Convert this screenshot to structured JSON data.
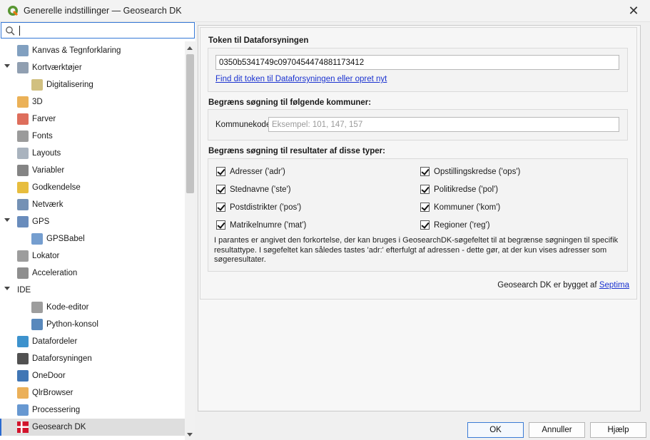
{
  "window": {
    "title": "Generelle indstillinger — Geosearch DK",
    "close_glyph": "✕"
  },
  "search": {
    "value": "",
    "placeholder": ""
  },
  "sidebar": {
    "items": [
      {
        "label": "Kanvas & Tegnforklaring",
        "icon": "canvas-icon",
        "indent": 0
      },
      {
        "label": "Kortværktøjer",
        "icon": "map-tools-icon",
        "indent": 0,
        "expanded": true
      },
      {
        "label": "Digitalisering",
        "icon": "digitizing-icon",
        "indent": 1
      },
      {
        "label": "3D",
        "icon": "3d-icon",
        "indent": 0
      },
      {
        "label": "Farver",
        "icon": "colors-icon",
        "indent": 0
      },
      {
        "label": "Fonts",
        "icon": "fonts-icon",
        "indent": 0
      },
      {
        "label": "Layouts",
        "icon": "layouts-icon",
        "indent": 0
      },
      {
        "label": "Variabler",
        "icon": "variables-icon",
        "indent": 0
      },
      {
        "label": "Godkendelse",
        "icon": "lock-icon",
        "indent": 0
      },
      {
        "label": "Netværk",
        "icon": "network-icon",
        "indent": 0
      },
      {
        "label": "GPS",
        "icon": "gps-icon",
        "indent": 0,
        "expanded": true
      },
      {
        "label": "GPSBabel",
        "icon": "gpsbabel-icon",
        "indent": 1
      },
      {
        "label": "Lokator",
        "icon": "locator-icon",
        "indent": 0
      },
      {
        "label": "Acceleration",
        "icon": "acceleration-icon",
        "indent": 0
      },
      {
        "label": "IDE",
        "icon": "",
        "indent": 0,
        "expanded": true
      },
      {
        "label": "Kode-editor",
        "icon": "code-editor-icon",
        "indent": 1
      },
      {
        "label": "Python-konsol",
        "icon": "python-icon",
        "indent": 1
      },
      {
        "label": "Datafordeler",
        "icon": "datafordeler-icon",
        "indent": 0
      },
      {
        "label": "Dataforsyningen",
        "icon": "dataforsyningen-icon",
        "indent": 0
      },
      {
        "label": "OneDoor",
        "icon": "onedoor-icon",
        "indent": 0
      },
      {
        "label": "QlrBrowser",
        "icon": "qlrbrowser-icon",
        "indent": 0
      },
      {
        "label": "Processering",
        "icon": "processing-icon",
        "indent": 0
      },
      {
        "label": "Geosearch DK",
        "icon": "danish-flag-icon",
        "indent": 0,
        "selected": true
      }
    ]
  },
  "token": {
    "section_title": "Token til Dataforsyningen",
    "value": "0350b5341749c0970454474881173412",
    "link": "Find dit token til Dataforsyningen eller opret nyt"
  },
  "municipalities": {
    "section_title": "Begræns søgning til følgende kommuner:",
    "label": "Kommunekoder:",
    "value": "",
    "placeholder": "Eksempel: 101, 147, 157"
  },
  "types": {
    "section_title": "Begræns søgning til resultater af disse typer:",
    "left": [
      {
        "label": "Adresser ('adr')",
        "checked": true
      },
      {
        "label": "Stednavne ('ste')",
        "checked": true
      },
      {
        "label": "Postdistrikter ('pos')",
        "checked": true
      },
      {
        "label": "Matrikelnumre ('mat')",
        "checked": true
      }
    ],
    "right": [
      {
        "label": "Opstillingskredse ('ops')",
        "checked": true
      },
      {
        "label": "Politikredse ('pol')",
        "checked": true
      },
      {
        "label": "Kommuner ('kom')",
        "checked": true
      },
      {
        "label": "Regioner ('reg')",
        "checked": true
      }
    ],
    "note": "I parantes er angivet den forkortelse, der kan bruges i GeosearchDK-søgefeltet til at begrænse søgningen til specifik resultattype. I søgefeltet kan således tastes 'adr:' efterfulgt af adressen - dette gør, at der kun vises adresser som søgeresultater."
  },
  "footer": {
    "text": "Geosearch DK er bygget af ",
    "link": "Septima"
  },
  "buttons": {
    "ok": "OK",
    "cancel": "Annuller",
    "help": "Hjælp"
  }
}
